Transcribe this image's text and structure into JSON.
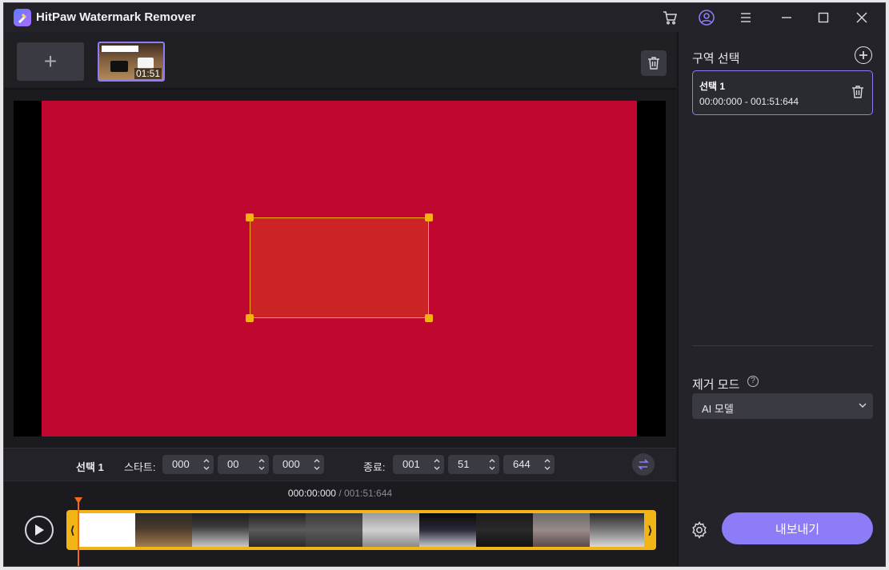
{
  "window": {
    "title": "HitPaw Watermark Remover"
  },
  "thumbnails": [
    {
      "duration": "01:51"
    }
  ],
  "controls": {
    "selection_label": "선택 1",
    "start_label": "스타트:",
    "start": {
      "h": "000",
      "m": "00",
      "ms": "000"
    },
    "end_label": "종료:",
    "end": {
      "h": "001",
      "m": "51",
      "ms": "644"
    }
  },
  "timeline": {
    "current": "000:00:000",
    "separator": " / ",
    "total": "001:51:644"
  },
  "sidebar": {
    "region_title": "구역 선택",
    "region": {
      "name": "선택 1",
      "range": "00:00:000 - 001:51:644"
    },
    "mode_title": "제거 모드",
    "mode_value": "AI 모델",
    "export_label": "내보내기"
  },
  "colors": {
    "accent": "#8c7cf7",
    "video_bg": "#c0072f",
    "selection": "#f6b10f",
    "playhead": "#f26a1b"
  },
  "icons": [
    "app-logo-icon",
    "cart-icon",
    "account-icon",
    "menu-icon",
    "minimize-icon",
    "maximize-icon",
    "close-icon",
    "trash-icon",
    "swap-icon",
    "play-icon",
    "plus-circle-icon",
    "help-icon",
    "chevron-down-icon",
    "gear-icon"
  ]
}
